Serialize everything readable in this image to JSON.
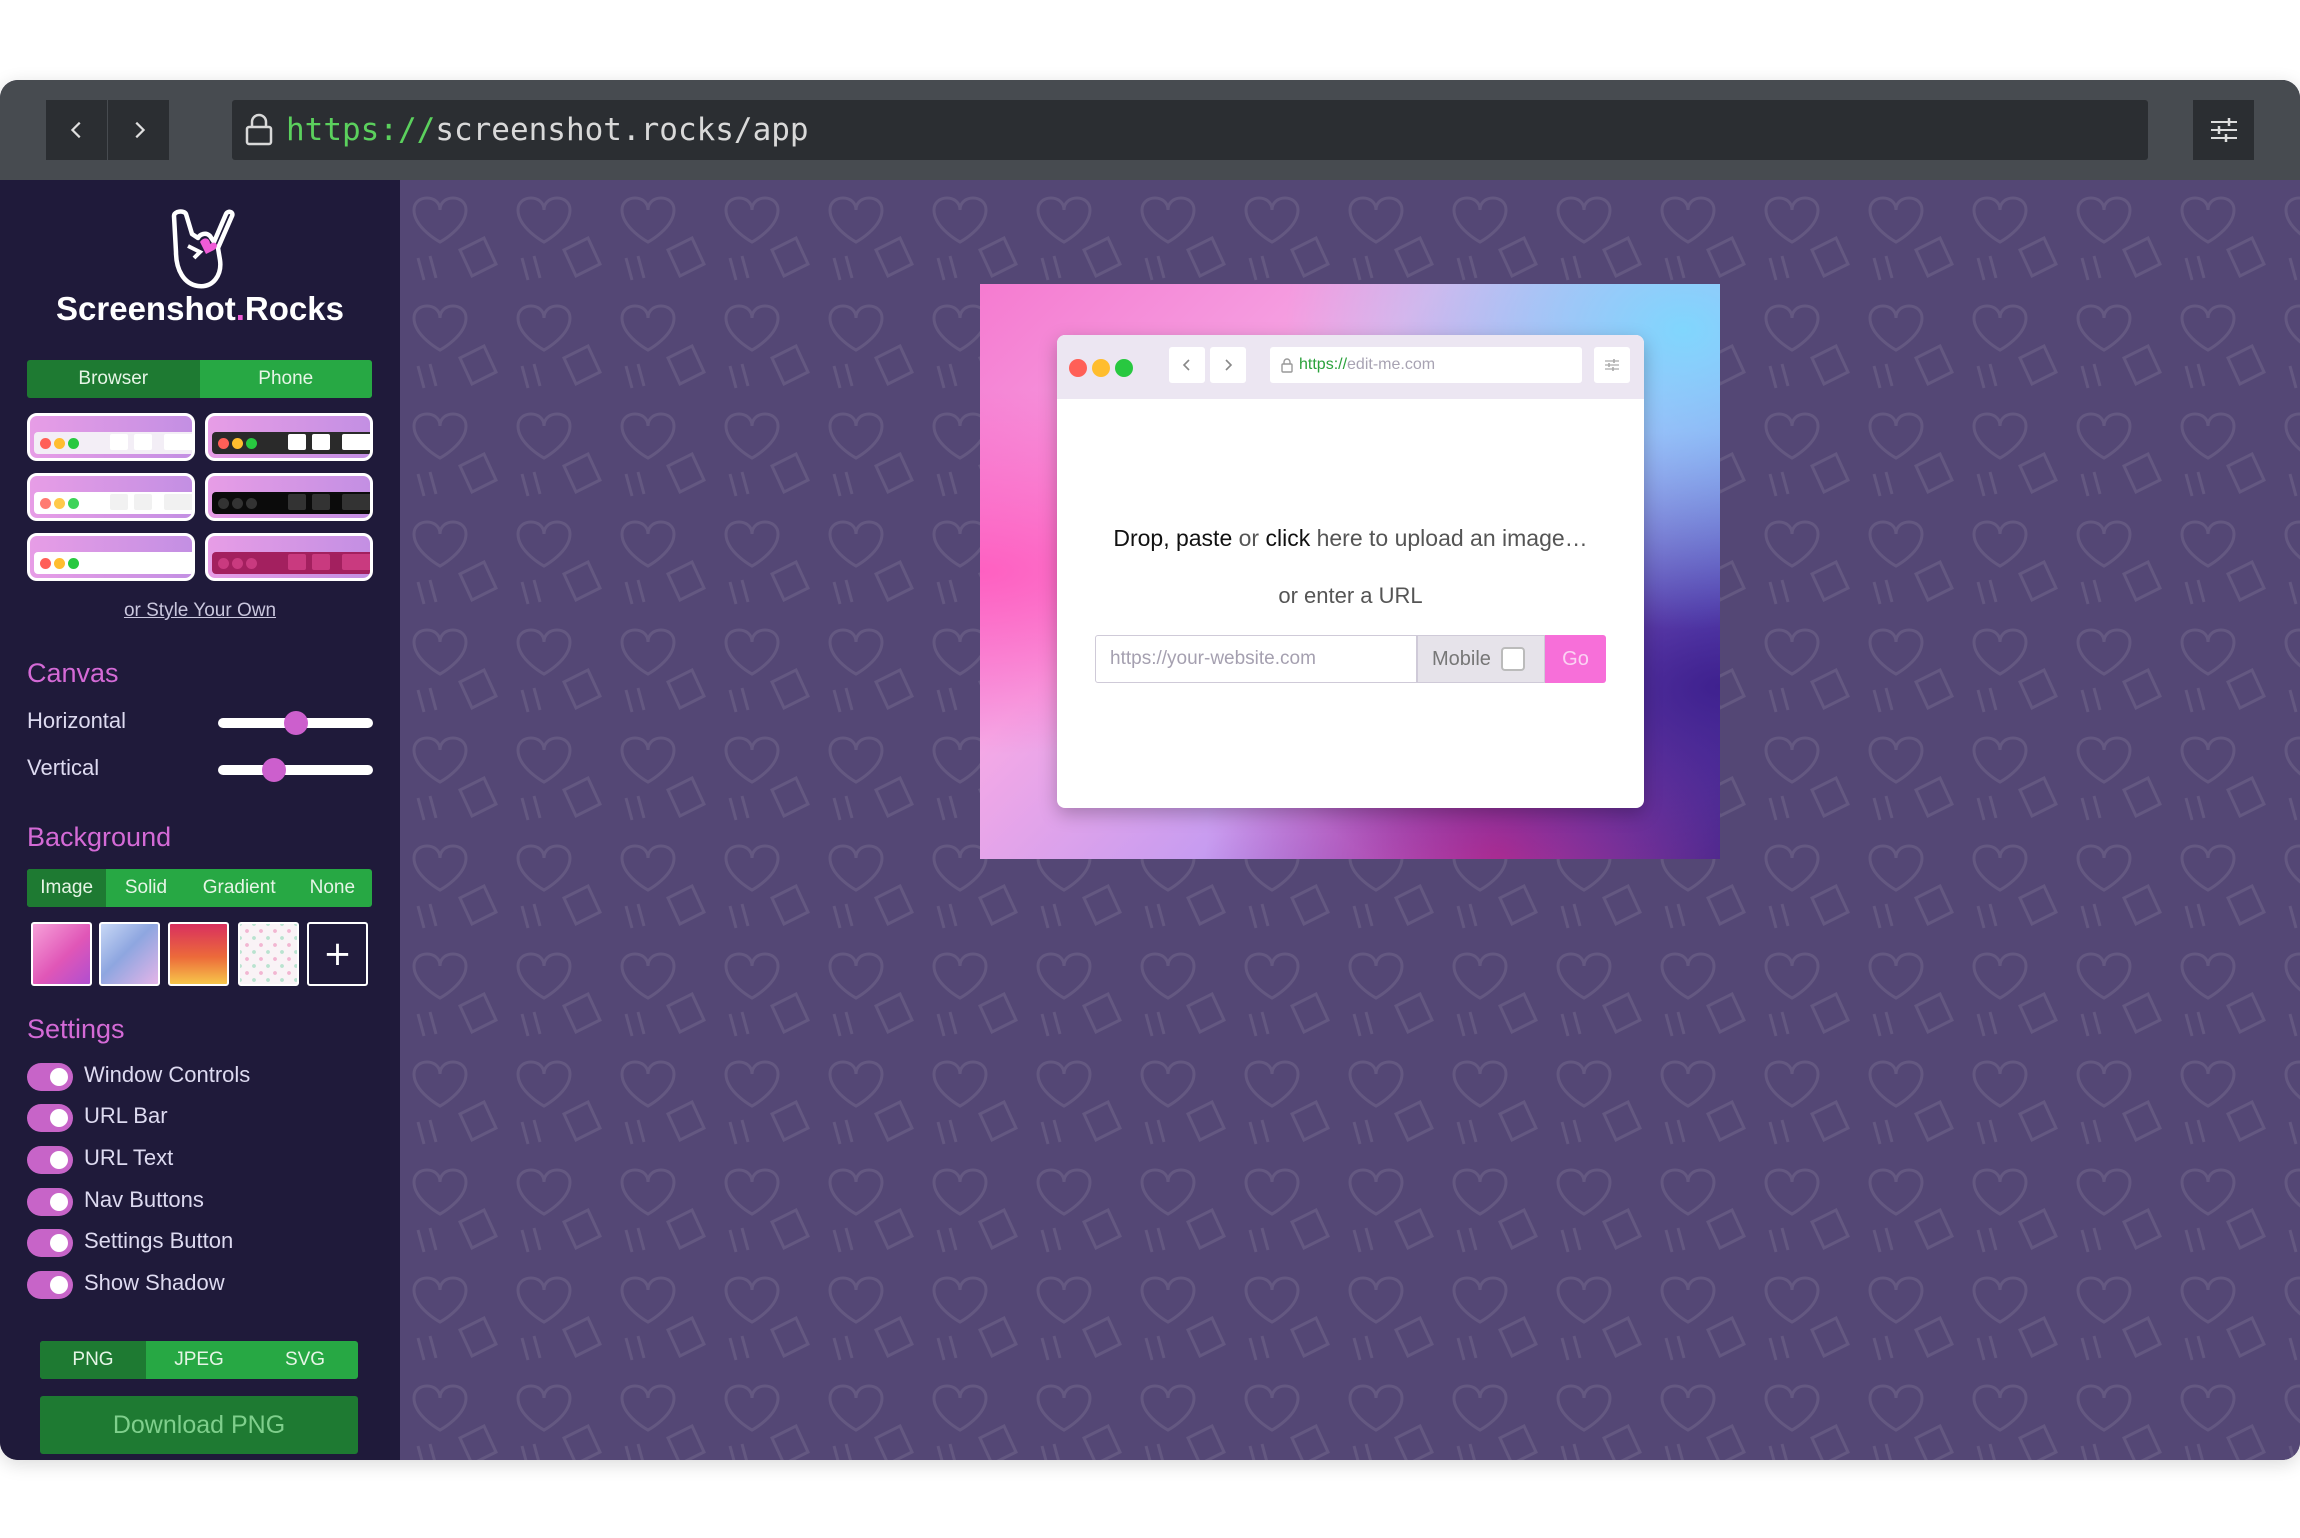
{
  "browser": {
    "url_protocol": "https://",
    "url_host": "screenshot.rocks/app"
  },
  "sidebar": {
    "brand_name": "Screenshot",
    "brand_dot": ".",
    "brand_suffix": "Rocks",
    "mode_tabs": [
      {
        "label": "Browser",
        "active": false
      },
      {
        "label": "Phone",
        "active": true
      }
    ],
    "style_link": "or Style Your Own",
    "canvas": {
      "title": "Canvas",
      "horizontal_label": "Horizontal",
      "horizontal_value": 0.5,
      "vertical_label": "Vertical",
      "vertical_value": 0.36
    },
    "background": {
      "title": "Background",
      "tabs": [
        {
          "label": "Image",
          "active": true
        },
        {
          "label": "Solid",
          "active": false
        },
        {
          "label": "Gradient",
          "active": false
        },
        {
          "label": "None",
          "active": false
        }
      ],
      "add_label": "+"
    },
    "settings": {
      "title": "Settings",
      "toggles": [
        {
          "label": "Window Controls",
          "on": true
        },
        {
          "label": "URL Bar",
          "on": true
        },
        {
          "label": "URL Text",
          "on": true
        },
        {
          "label": "Nav Buttons",
          "on": true
        },
        {
          "label": "Settings Button",
          "on": true
        },
        {
          "label": "Show Shadow",
          "on": true
        }
      ]
    },
    "formats": [
      {
        "label": "PNG",
        "active": false
      },
      {
        "label": "JPEG",
        "active": true
      },
      {
        "label": "SVG",
        "active": true
      }
    ],
    "download_label": "Download PNG"
  },
  "preview": {
    "url_protocol": "https://",
    "url_host": "edit-me.com",
    "drop_word1": "Drop",
    "drop_sep1": ", ",
    "drop_word2": "paste",
    "drop_sep2": " or ",
    "drop_word3": "click",
    "drop_rest": " here to upload an image…",
    "or_url": "or enter a URL",
    "url_placeholder": "https://your-website.com",
    "mobile_label": "Mobile",
    "go_label": "Go"
  },
  "colors": {
    "accent_green": "#27a844",
    "accent_pink": "#d46ad6",
    "main_bg": "#544775",
    "sidebar_bg": "#1f1a3a"
  }
}
